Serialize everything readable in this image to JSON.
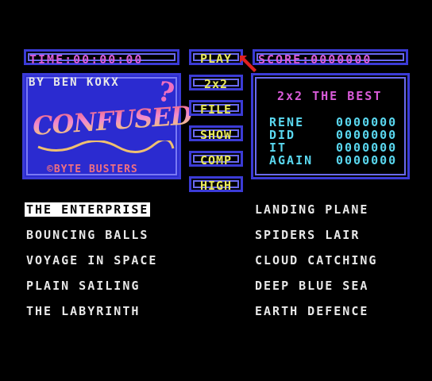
{
  "timer": {
    "text": "TIME:00:00:00"
  },
  "score": {
    "text": "SCORE:0000000"
  },
  "buttons": {
    "play": "PLAY",
    "mode": "2x2",
    "file": "FILE",
    "show": "SHOW",
    "comp": "COMP",
    "high": "HIGH"
  },
  "logo": {
    "credit": "BY BEN KOKX",
    "title": "CONFUSED",
    "question": "?",
    "publisher": "©BYTE BUSTERS"
  },
  "highscores": {
    "title": "2x2 THE BEST",
    "rows": [
      {
        "name": "RENE",
        "score": "0000000"
      },
      {
        "name": "DID",
        "score": "0000000"
      },
      {
        "name": "IT",
        "score": "0000000"
      },
      {
        "name": "AGAIN",
        "score": "0000000"
      }
    ]
  },
  "games": {
    "left": [
      "THE ENTERPRISE",
      "BOUNCING BALLS",
      "VOYAGE IN SPACE",
      "PLAIN SAILING",
      "THE LABYRINTH"
    ],
    "right": [
      "LANDING PLANE",
      "SPIDERS LAIR",
      "CLOUD CATCHING",
      "DEEP BLUE SEA",
      "EARTH DEFENCE"
    ]
  },
  "colors": {
    "frame": "#3b3bd6",
    "magenta": "#d95bd9",
    "yellow": "#e8e85a",
    "cyan": "#5ad8f0",
    "cursor": "#e02020"
  },
  "cursor_icon": "arrow-cursor-icon"
}
